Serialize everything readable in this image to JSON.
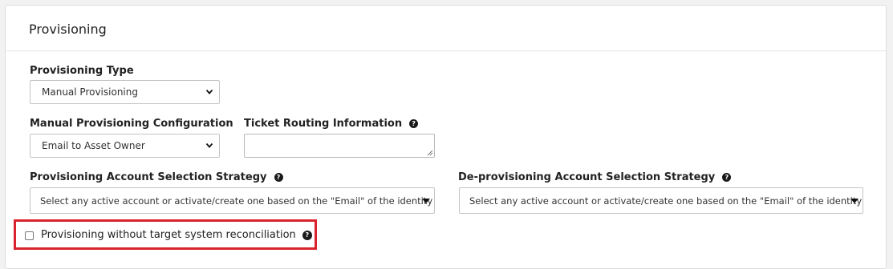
{
  "section": {
    "title": "Provisioning"
  },
  "provisioning_type": {
    "label": "Provisioning Type",
    "value": "Manual Provisioning"
  },
  "manual_config": {
    "label": "Manual Provisioning Configuration",
    "value": "Email to Asset Owner"
  },
  "ticket_routing": {
    "label": "Ticket Routing Information",
    "value": "",
    "help_icon": "question-circle-icon"
  },
  "provisioning_strategy": {
    "label": "Provisioning Account Selection Strategy",
    "value": "Select any active account or activate/create one based on the \"Email\" of the identity",
    "help_icon": "question-circle-icon"
  },
  "deprovisioning_strategy": {
    "label": "De-provisioning Account Selection Strategy",
    "value": "Select any active account or activate/create one based on the \"Email\" of the identity",
    "help_icon": "question-circle-icon"
  },
  "reconciliation": {
    "label": "Provisioning without target system reconciliation",
    "checked": false,
    "help_icon": "question-circle-icon"
  },
  "colors": {
    "highlight_border": "#d9232d",
    "panel_background": "#ffffff",
    "page_background": "#f2f2f2"
  }
}
